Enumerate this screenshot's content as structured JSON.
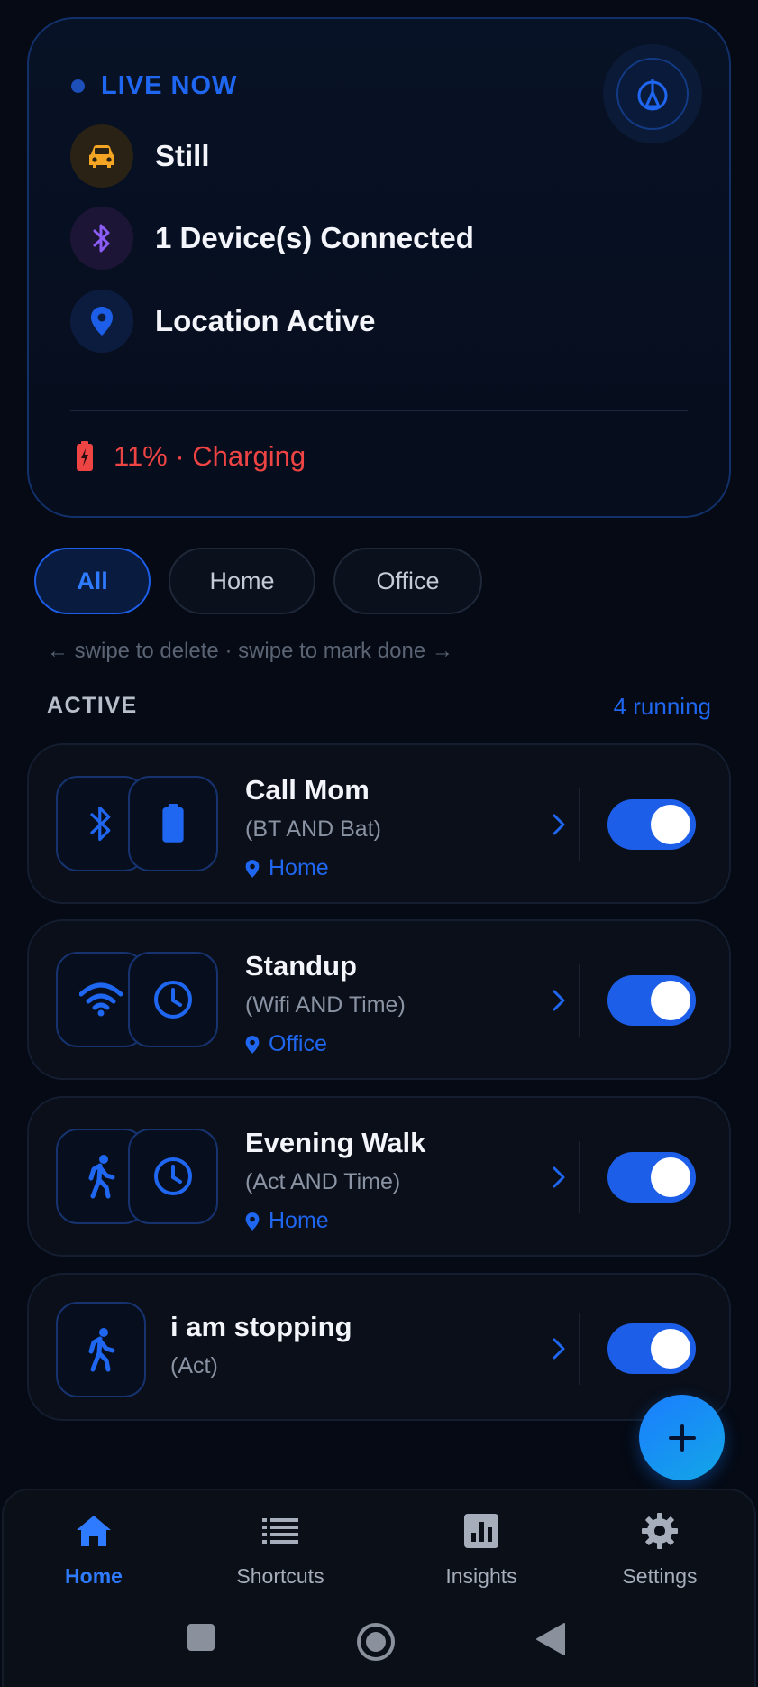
{
  "live": {
    "title": "LIVE NOW",
    "status": [
      {
        "label": "Still",
        "icon": "car-icon",
        "color": "#f5a524"
      },
      {
        "label": "1 Device(s) Connected",
        "icon": "bluetooth-icon",
        "color": "#8b5cf6"
      },
      {
        "label": "Location Active",
        "icon": "location-pin-icon",
        "color": "#1d5ee8"
      }
    ],
    "battery": {
      "text": "11% · Charging",
      "icon": "battery-charging-icon",
      "color": "#ef4444"
    },
    "compass_icon": "compass-icon"
  },
  "filters": {
    "chips": [
      {
        "label": "All",
        "selected": true
      },
      {
        "label": "Home",
        "selected": false
      },
      {
        "label": "Office",
        "selected": false
      }
    ]
  },
  "hint": "← swipe to delete  ·  swipe to mark done →",
  "section": {
    "title": "ACTIVE",
    "count": "4 running"
  },
  "shortcuts": [
    {
      "name": "Call Mom",
      "condition": "(BT AND Bat)",
      "location": "Home",
      "icons": [
        "bluetooth-icon",
        "battery-icon"
      ],
      "enabled": true
    },
    {
      "name": "Standup",
      "condition": "(Wifi AND Time)",
      "location": "Office",
      "icons": [
        "wifi-icon",
        "clock-icon"
      ],
      "enabled": true
    },
    {
      "name": "Evening Walk",
      "condition": "(Act AND Time)",
      "location": "Home",
      "icons": [
        "walking-icon",
        "clock-icon"
      ],
      "enabled": true
    },
    {
      "name": "i am stopping",
      "condition": "(Act)",
      "location": "",
      "icons": [
        "walking-icon"
      ],
      "enabled": true
    }
  ],
  "nav": {
    "items": [
      {
        "label": "Home",
        "icon": "home-icon",
        "active": true
      },
      {
        "label": "Shortcuts",
        "icon": "list-icon",
        "active": false
      },
      {
        "label": "Insights",
        "icon": "insights-icon",
        "active": false
      },
      {
        "label": "Settings",
        "icon": "gear-icon",
        "active": false
      }
    ]
  },
  "colors": {
    "accent": "#1f66f0",
    "background": "#050a14",
    "danger": "#ef4444"
  }
}
